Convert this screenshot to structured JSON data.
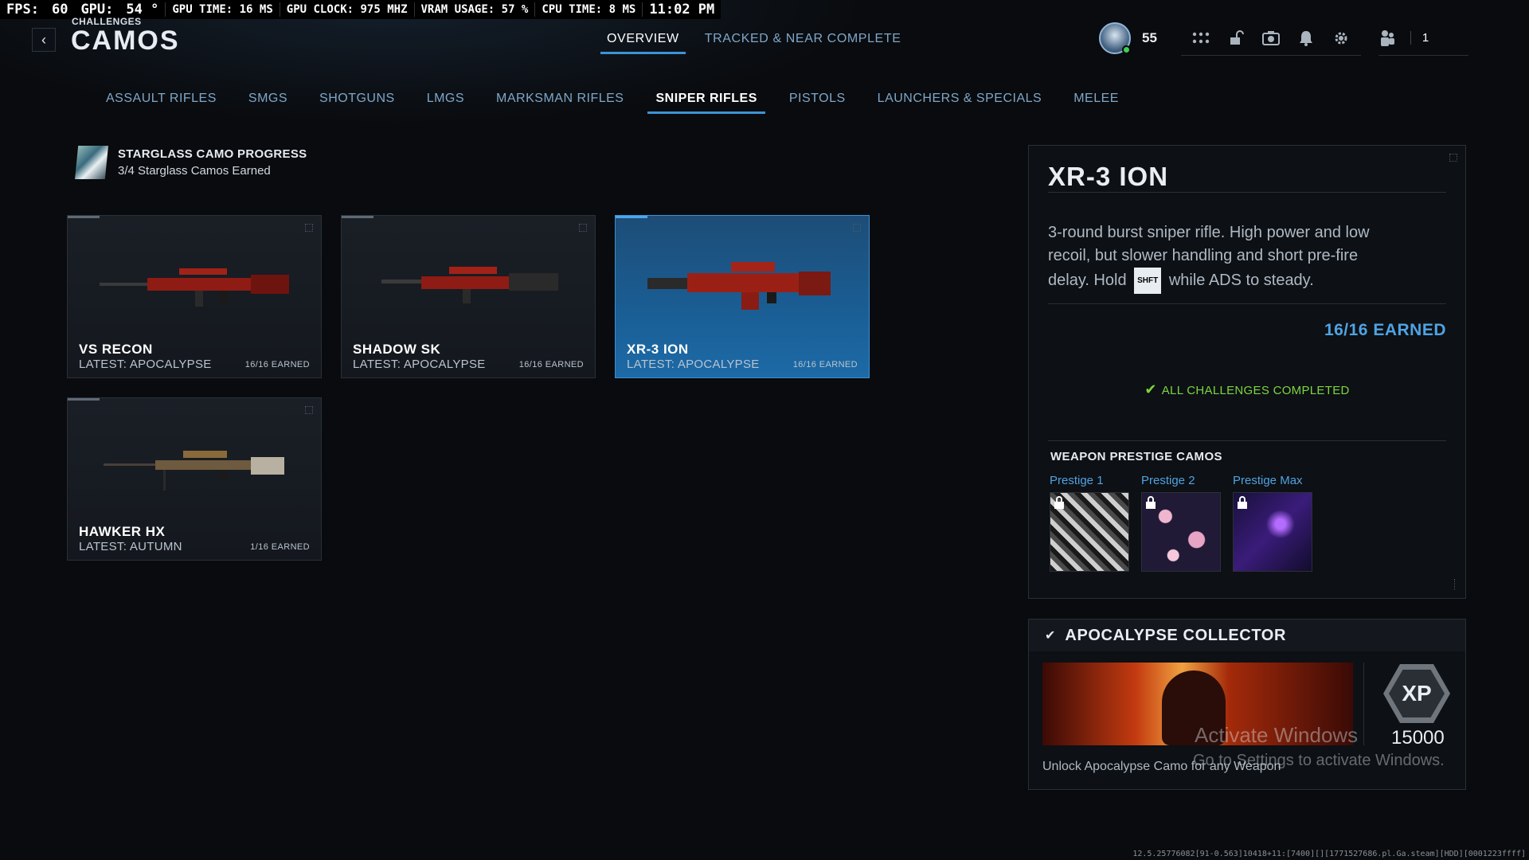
{
  "perf": {
    "fps_label": "FPS:",
    "fps": "60",
    "gpu_label": "GPU:",
    "gpu": "54 °",
    "gpu_time": "GPU TIME: 16 MS",
    "gpu_clock": "GPU CLOCK: 975 MHZ",
    "vram": "VRAM USAGE: 57 %",
    "cpu_time": "CPU TIME: 8 MS",
    "clock": "11:02 PM"
  },
  "header": {
    "breadcrumb": "CHALLENGES",
    "title": "CAMOS",
    "back_glyph": "‹",
    "tabs": [
      "OVERVIEW",
      "TRACKED & NEAR COMPLETE"
    ],
    "level": "55",
    "party_count": "1"
  },
  "categories": [
    "ASSAULT RIFLES",
    "SMGS",
    "SHOTGUNS",
    "LMGS",
    "MARKSMAN RIFLES",
    "SNIPER RIFLES",
    "PISTOLS",
    "LAUNCHERS & SPECIALS",
    "MELEE"
  ],
  "progress": {
    "title": "STARGLASS CAMO PROGRESS",
    "subtitle": "3/4 Starglass Camos Earned"
  },
  "weapons": [
    {
      "name": "VS RECON",
      "latest": "LATEST: APOCALYPSE",
      "earned": "16/16 EARNED"
    },
    {
      "name": "SHADOW SK",
      "latest": "LATEST: APOCALYPSE",
      "earned": "16/16 EARNED"
    },
    {
      "name": "XR-3 ION",
      "latest": "LATEST: APOCALYPSE",
      "earned": "16/16 EARNED"
    },
    {
      "name": "HAWKER HX",
      "latest": "LATEST: AUTUMN",
      "earned": "1/16 EARNED"
    }
  ],
  "detail": {
    "title": "XR-3 ION",
    "desc_before": "3-round burst sniper rifle. High power and low recoil, but slower handling and short pre-fire delay. Hold",
    "key": "SHFT",
    "desc_after": "while ADS to steady.",
    "earned": "16/16 EARNED",
    "completed": "ALL CHALLENGES COMPLETED",
    "prestige_title": "WEAPON PRESTIGE CAMOS",
    "prestige": [
      "Prestige 1",
      "Prestige 2",
      "Prestige Max"
    ]
  },
  "collector": {
    "title": "APOCALYPSE COLLECTOR",
    "xp_label": "XP",
    "xp_amount": "15000",
    "description": "Unlock Apocalypse Camo for any Weapon"
  },
  "overlay": {
    "activate_title": "Activate Windows",
    "activate_sub": "Go to Settings to activate Windows.",
    "build": "12.5.25776082[91-0.563]10418+11:[7400][][1771527686.pl.Ga.steam][HDD][0001223ffff]"
  },
  "colors": {
    "accent": "#3d93d6",
    "earned_blue": "#4fa3e3",
    "complete_green": "#7cd640",
    "selected_card": "#1a5e95"
  },
  "icons": [
    "rank-emblem-icon",
    "grid-icon",
    "lock-open-icon",
    "camera-icon",
    "bell-icon",
    "gear-icon",
    "party-icon",
    "check-icon",
    "lock-icon"
  ]
}
